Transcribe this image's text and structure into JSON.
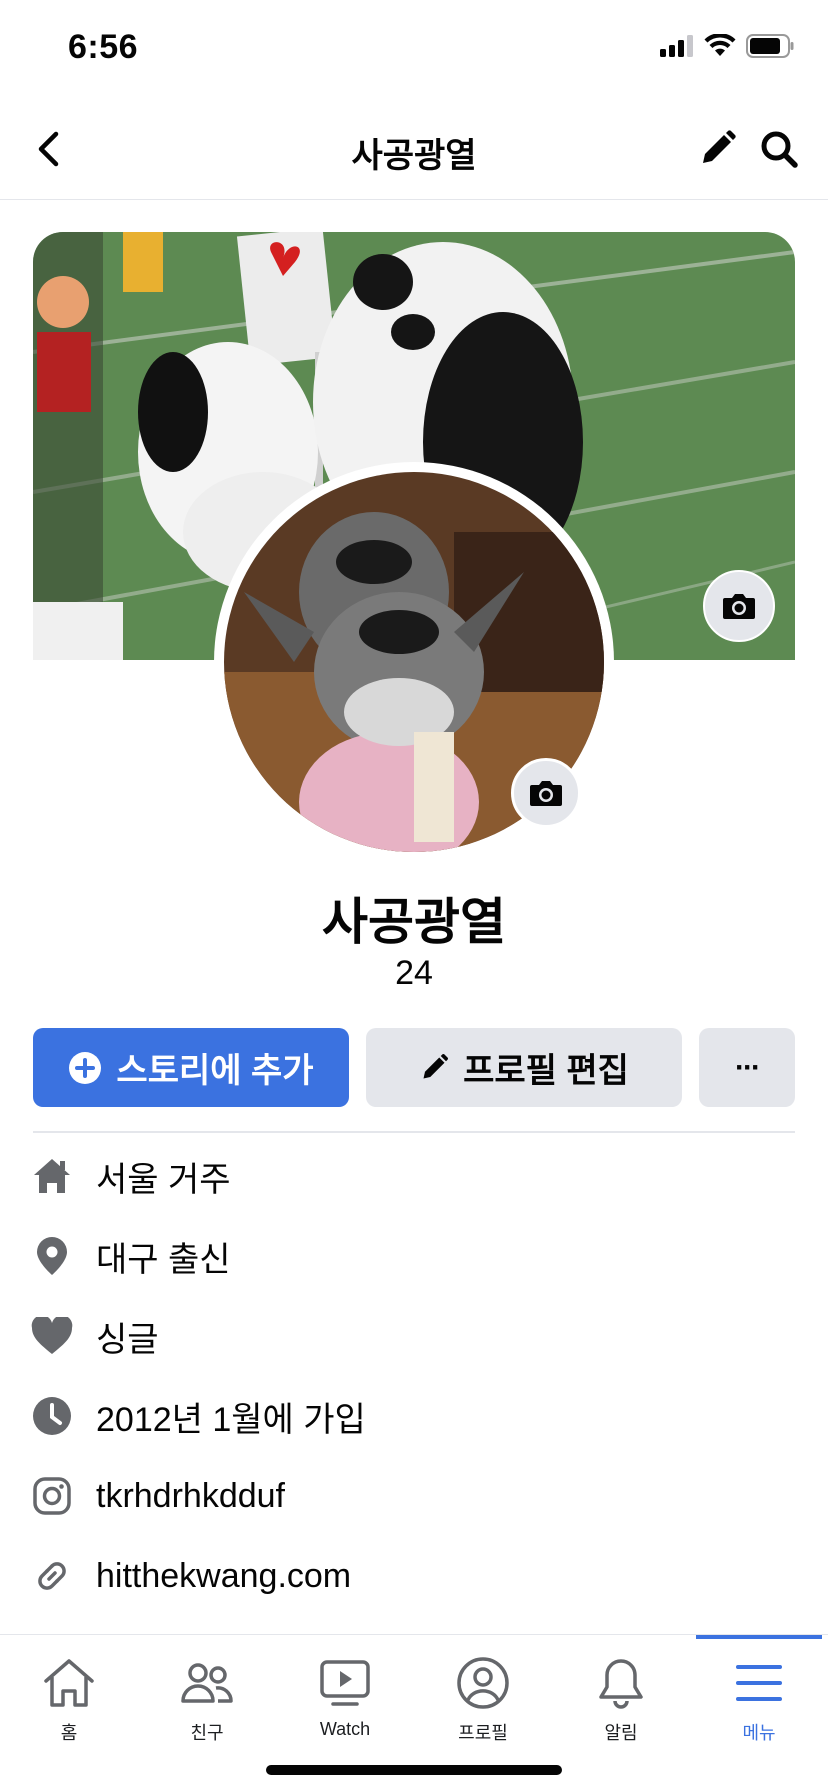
{
  "status_bar": {
    "time": "6:56"
  },
  "header": {
    "title": "사공광열"
  },
  "profile": {
    "name": "사공광열",
    "subtitle": "24"
  },
  "actions": {
    "add_story_label": "스토리에 추가",
    "edit_profile_label": "프로필 편집",
    "more_label": "···"
  },
  "info": [
    {
      "icon": "home-icon",
      "text": "서울 거주"
    },
    {
      "icon": "location-pin-icon",
      "text": "대구 출신"
    },
    {
      "icon": "heart-icon",
      "text": "싱글"
    },
    {
      "icon": "clock-icon",
      "text": "2012년 1월에 가입"
    },
    {
      "icon": "instagram-icon",
      "text": "tkrhdrhkdduf"
    },
    {
      "icon": "link-icon",
      "text": "hitthekwang.com"
    }
  ],
  "tabs": [
    {
      "icon": "home-icon",
      "label": "홈"
    },
    {
      "icon": "friends-icon",
      "label": "친구"
    },
    {
      "icon": "watch-icon",
      "label": "Watch"
    },
    {
      "icon": "profile-icon",
      "label": "프로필"
    },
    {
      "icon": "bell-icon",
      "label": "알림"
    },
    {
      "icon": "menu-icon",
      "label": "메뉴",
      "active": true
    }
  ],
  "colors": {
    "accent": "#3b72e0",
    "secondary_button": "#e4e6eb",
    "icon_gray": "#65676b"
  }
}
